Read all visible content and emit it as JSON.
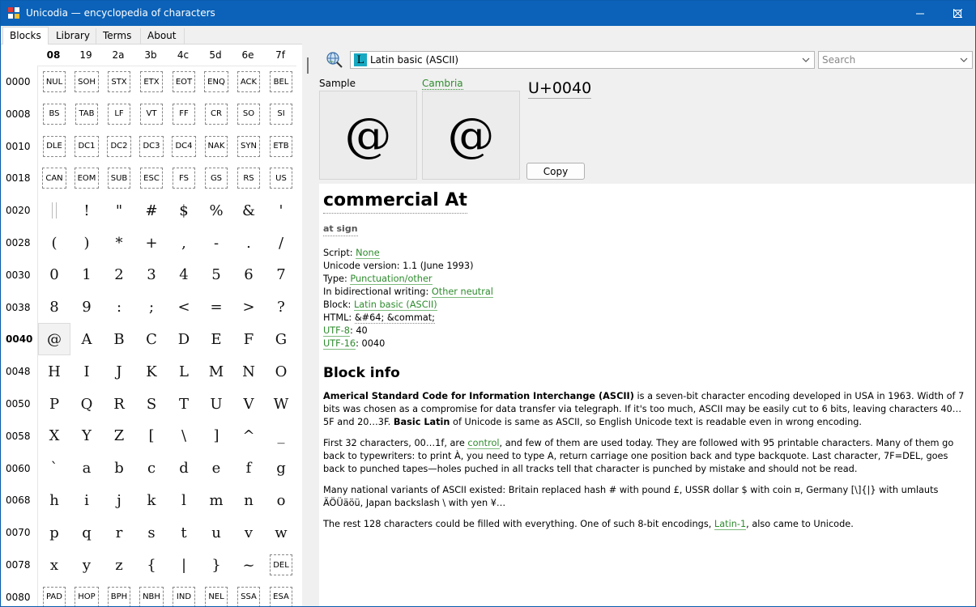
{
  "window": {
    "title": "Unicodia — encyclopedia of characters"
  },
  "tabs": [
    {
      "label": "Blocks",
      "active": true
    },
    {
      "label": "Library"
    },
    {
      "label": "Terms"
    },
    {
      "label": "About"
    }
  ],
  "grid": {
    "columns": [
      "08",
      "19",
      "2a",
      "3b",
      "4c",
      "5d",
      "6e",
      "7f"
    ],
    "bold_column": 0,
    "rows": [
      {
        "label": "0000",
        "cells": [
          "NUL",
          "SOH",
          "STX",
          "ETX",
          "EOT",
          "ENQ",
          "ACK",
          "BEL"
        ],
        "control": true
      },
      {
        "label": "0008",
        "cells": [
          "BS",
          "TAB",
          "LF",
          "VT",
          "FF",
          "CR",
          "SO",
          "SI"
        ],
        "control": true
      },
      {
        "label": "0010",
        "cells": [
          "DLE",
          "DC1",
          "DC2",
          "DC3",
          "DC4",
          "NAK",
          "SYN",
          "ETB"
        ],
        "control": true
      },
      {
        "label": "0018",
        "cells": [
          "CAN",
          "EOM",
          "SUB",
          "ESC",
          "FS",
          "GS",
          "RS",
          "US"
        ],
        "control": true
      },
      {
        "label": "0020",
        "cells": [
          " ",
          "!",
          "\"",
          "#",
          "$",
          "%",
          "&",
          "'"
        ]
      },
      {
        "label": "0028",
        "cells": [
          "(",
          ")",
          "*",
          "+",
          ",",
          "-",
          ".",
          "/"
        ]
      },
      {
        "label": "0030",
        "cells": [
          "0",
          "1",
          "2",
          "3",
          "4",
          "5",
          "6",
          "7"
        ]
      },
      {
        "label": "0038",
        "cells": [
          "8",
          "9",
          ":",
          ";",
          "<",
          "=",
          ">",
          "?"
        ]
      },
      {
        "label": "0040",
        "cells": [
          "@",
          "A",
          "B",
          "C",
          "D",
          "E",
          "F",
          "G"
        ],
        "bold": true
      },
      {
        "label": "0048",
        "cells": [
          "H",
          "I",
          "J",
          "K",
          "L",
          "M",
          "N",
          "O"
        ]
      },
      {
        "label": "0050",
        "cells": [
          "P",
          "Q",
          "R",
          "S",
          "T",
          "U",
          "V",
          "W"
        ]
      },
      {
        "label": "0058",
        "cells": [
          "X",
          "Y",
          "Z",
          "[",
          "\\",
          "]",
          "^",
          "_"
        ]
      },
      {
        "label": "0060",
        "cells": [
          "`",
          "a",
          "b",
          "c",
          "d",
          "e",
          "f",
          "g"
        ]
      },
      {
        "label": "0068",
        "cells": [
          "h",
          "i",
          "j",
          "k",
          "l",
          "m",
          "n",
          "o"
        ]
      },
      {
        "label": "0070",
        "cells": [
          "p",
          "q",
          "r",
          "s",
          "t",
          "u",
          "v",
          "w"
        ]
      },
      {
        "label": "0078",
        "cells": [
          "x",
          "y",
          "z",
          "{",
          "|",
          "}",
          "~",
          "DEL"
        ]
      },
      {
        "label": "0080",
        "cells": [
          "PAD",
          "HOP",
          "BPH",
          "NBH",
          "IND",
          "NEL",
          "SSA",
          "ESA"
        ],
        "control": true
      }
    ],
    "selected": {
      "row": 8,
      "col": 0
    }
  },
  "toolbar": {
    "block_value": "Latin basic (ASCII)",
    "block_icon_glyph": "L",
    "search_placeholder": "Search"
  },
  "preview": {
    "sample_label": "Sample",
    "font_label": "Cambria",
    "glyph": "@",
    "code": "U+0040",
    "copy_label": "Copy"
  },
  "info": {
    "name": "commercial At",
    "alias": "at sign",
    "script_label": "Script: ",
    "script_value": "None",
    "version_label": "Unicode version: 1.1 (June 1993)",
    "type_label": "Type: ",
    "type_value": "Punctuation/other",
    "bidi_label": "In bidirectional writing: ",
    "bidi_value": "Other neutral",
    "block_label": "Block: ",
    "block_value": "Latin basic (ASCII)",
    "html_label": "HTML: ",
    "html_value": "&#64; &commat;",
    "utf8_label": "UTF-8",
    "utf8_value": ": 40",
    "utf16_label": "UTF-16",
    "utf16_value": ": 0040",
    "block_info_title": "Block info",
    "p1_bold": "Americal Standard Code for Information Interchange (ASCII)",
    "p1_text": " is a seven-bit character encoding developed in USA in 1963. Width of 7 bits was chosen as a compromise for data transfer via telegraph. If it's too much, ASCII may be easily cut to 6 bits, leaving characters 40…5F and 20…3F. ",
    "p1_bold2": "Basic Latin",
    "p1_text2": " of Unicode is same as ASCII, so English Unicode text is readable even in wrong encoding.",
    "p2_text1": "First 32 characters, 00…1f, are ",
    "p2_link": "control",
    "p2_text2": ", and few of them are used today. They are followed with 95 printable characters. Many of them go back to typewriters: to print À, you need to type A, return carriage one position back and type backquote. Last character, 7F=DEL, goes back to punched tapes—holes puched in all tracks tell that character is punched by mistake and should not be read.",
    "p3_text": "Many national variants of ASCII existed: Britain replaced hash # with pound £, USSR dollar $ with coin ¤, Germany [\\]{|} with umlauts ÄÖÜäöü, Japan backslash \\ with yen ¥…",
    "p4_text1": "The rest 128 characters could be filled with everything. One of such 8-bit encodings, ",
    "p4_link": "Latin-1",
    "p4_text2": ", also came to Unicode."
  }
}
